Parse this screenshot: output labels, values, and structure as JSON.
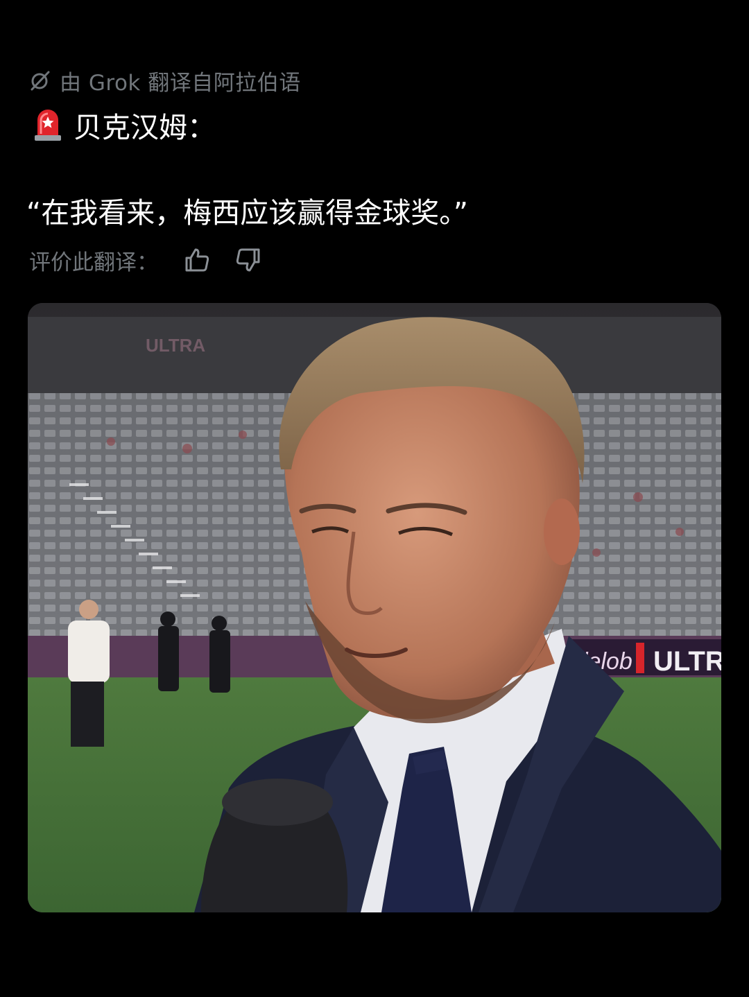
{
  "post": {
    "translation_note": "由 Grok 翻译自阿拉伯语",
    "translation_icon": "grok-icon",
    "headline_icon": "siren-icon",
    "headline": "贝克汉姆：",
    "quote": "“在我看来，梅西应该赢得金球奖。”",
    "rating": {
      "label": "评价此翻译：",
      "like_icon": "thumbs-up-icon",
      "dislike_icon": "thumbs-down-icon"
    }
  },
  "media": {
    "type": "video-still",
    "signage_left": "ULTRA",
    "signage_right": "ULTR",
    "signage_brand": "lelob"
  },
  "colors": {
    "background": "#000000",
    "primary_text": "#ffffff",
    "secondary_text": "#71767b"
  }
}
